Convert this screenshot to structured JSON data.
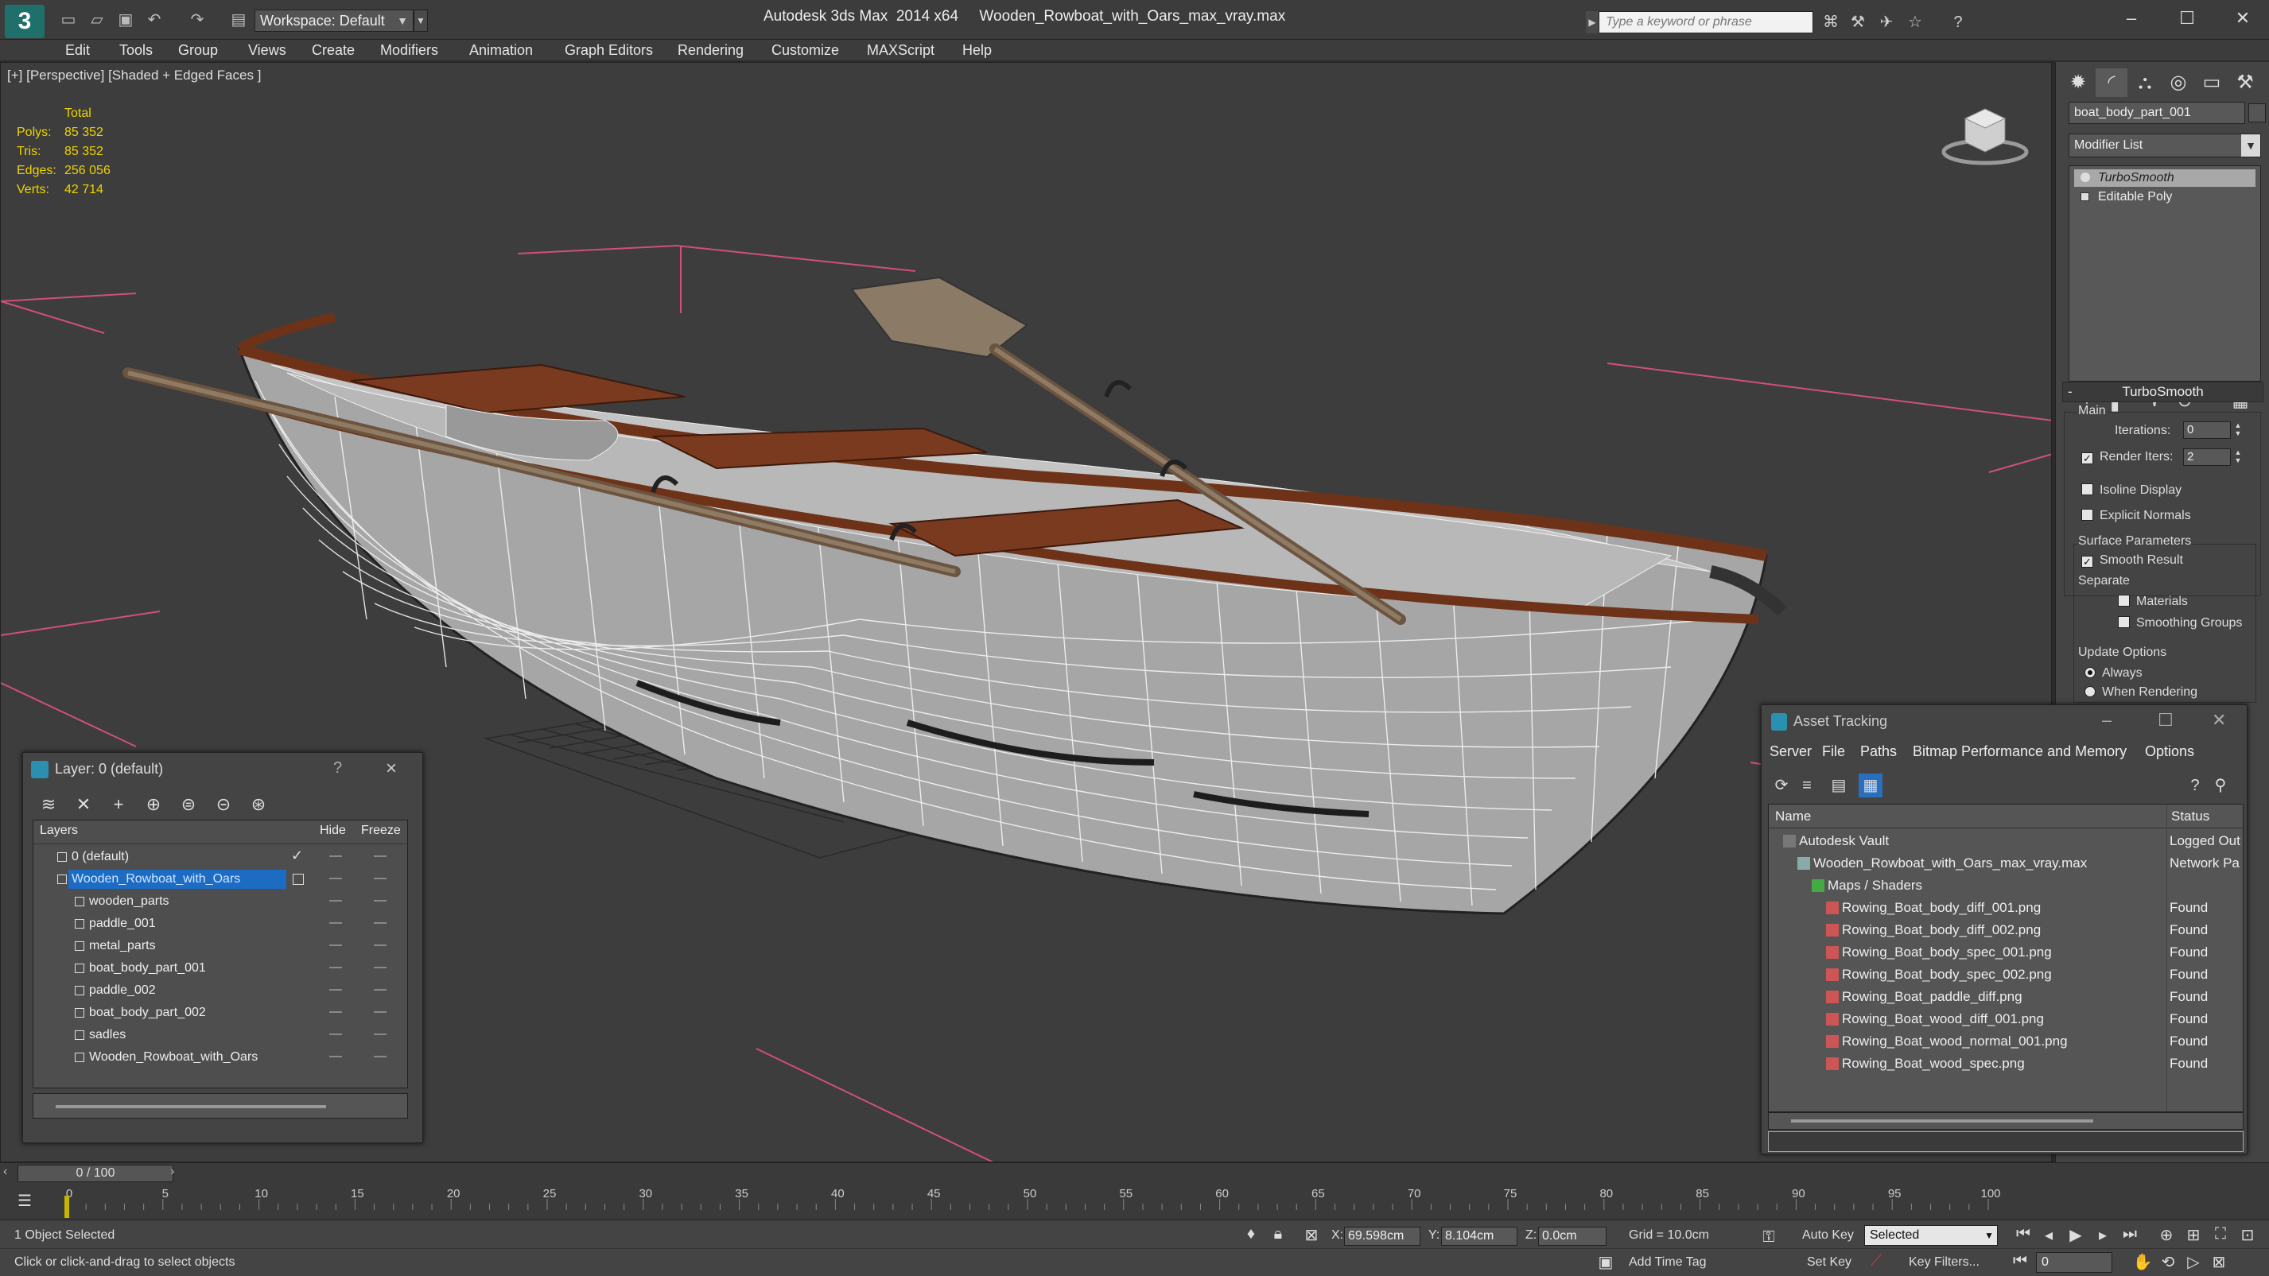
{
  "title_bar": {
    "workspace": "Workspace: Default",
    "window_title": "Autodesk 3ds Max  2014 x64     Wooden_Rowboat_with_Oars_max_vray.max",
    "search_placeholder": "Type a keyword or phrase"
  },
  "menu": [
    "Edit",
    "Tools",
    "Group",
    "Views",
    "Create",
    "Modifiers",
    "Animation",
    "Graph Editors",
    "Rendering",
    "Customize",
    "MAXScript",
    "Help"
  ],
  "viewport": {
    "label": "[+] [Perspective] [Shaded + Edged Faces ]",
    "stats": {
      "total_label": "Total",
      "rows": [
        {
          "label": "Polys:",
          "value": "85 352"
        },
        {
          "label": "Tris:",
          "value": "85 352"
        },
        {
          "label": "Edges:",
          "value": "256 056"
        },
        {
          "label": "Verts:",
          "value": "42 714"
        }
      ]
    },
    "colors": {
      "wire": "#ffffff",
      "hull": "#bdbdbd",
      "wood": "#7a3a1f",
      "grid_lines": "#d0507a",
      "background": "#3d3d3d"
    }
  },
  "command_panel": {
    "object_name": "boat_body_part_001",
    "modifier_list": "Modifier List",
    "stack": [
      "TurboSmooth",
      "Editable Poly"
    ],
    "rollout_title": "TurboSmooth",
    "main_group": "Main",
    "iterations_label": "Iterations:",
    "iterations_value": "0",
    "render_iters_label": "Render Iters:",
    "render_iters_value": "2",
    "isoline_display": "Isoline Display",
    "explicit_normals": "Explicit Normals",
    "surface_params_group": "Surface Parameters",
    "smooth_result": "Smooth Result",
    "separate_label": "Separate",
    "materials": "Materials",
    "smoothing_groups": "Smoothing Groups",
    "update_options_group": "Update Options",
    "always": "Always",
    "when_rendering": "When Rendering"
  },
  "layer_dialog": {
    "title": "Layer: 0 (default)",
    "help": "?",
    "columns": {
      "layers": "Layers",
      "hide": "Hide",
      "freeze": "Freeze"
    },
    "rows": [
      {
        "name": "0 (default)"
      },
      {
        "name": "Wooden_Rowboat_with_Oars"
      },
      {
        "name": "wooden_parts"
      },
      {
        "name": "paddle_001"
      },
      {
        "name": "metal_parts"
      },
      {
        "name": "boat_body_part_001"
      },
      {
        "name": "paddle_002"
      },
      {
        "name": "boat_body_part_002"
      },
      {
        "name": "sadles"
      },
      {
        "name": "Wooden_Rowboat_with_Oars"
      }
    ]
  },
  "asset_dialog": {
    "title": "Asset Tracking",
    "menu": [
      "Server",
      "File",
      "Paths",
      "Bitmap Performance and Memory",
      "Options"
    ],
    "columns": {
      "name": "Name",
      "status": "Status"
    },
    "rows": [
      {
        "name": "Autodesk Vault",
        "status": "Logged Out"
      },
      {
        "name": "Wooden_Rowboat_with_Oars_max_vray.max",
        "status": "Network Pa"
      },
      {
        "name": "Maps / Shaders",
        "status": ""
      },
      {
        "name": "Rowing_Boat_body_diff_001.png",
        "status": "Found"
      },
      {
        "name": "Rowing_Boat_body_diff_002.png",
        "status": "Found"
      },
      {
        "name": "Rowing_Boat_body_spec_001.png",
        "status": "Found"
      },
      {
        "name": "Rowing_Boat_body_spec_002.png",
        "status": "Found"
      },
      {
        "name": "Rowing_Boat_paddle_diff.png",
        "status": "Found"
      },
      {
        "name": "Rowing_Boat_wood_diff_001.png",
        "status": "Found"
      },
      {
        "name": "Rowing_Boat_wood_normal_001.png",
        "status": "Found"
      },
      {
        "name": "Rowing_Boat_wood_spec.png",
        "status": "Found"
      }
    ]
  },
  "timeline": {
    "frame_display": "0 / 100",
    "ticks": [
      "0",
      "5",
      "10",
      "15",
      "20",
      "25",
      "30",
      "35",
      "40",
      "45",
      "50",
      "55",
      "60",
      "65",
      "70",
      "75",
      "80",
      "85",
      "90",
      "95",
      "100"
    ]
  },
  "status_bar": {
    "selection": "1 Object Selected",
    "prompt": "Click or click-and-drag to select objects",
    "x_label": "X:",
    "x_value": "69.598cm",
    "y_label": "Y:",
    "y_value": "8.104cm",
    "z_label": "Z:",
    "z_value": "0.0cm",
    "grid": "Grid = 10.0cm",
    "auto_key": "Auto Key",
    "selected": "Selected",
    "set_key": "Set Key",
    "key_filters": "Key Filters...",
    "add_time_tag": "Add Time Tag",
    "frame": "0"
  }
}
